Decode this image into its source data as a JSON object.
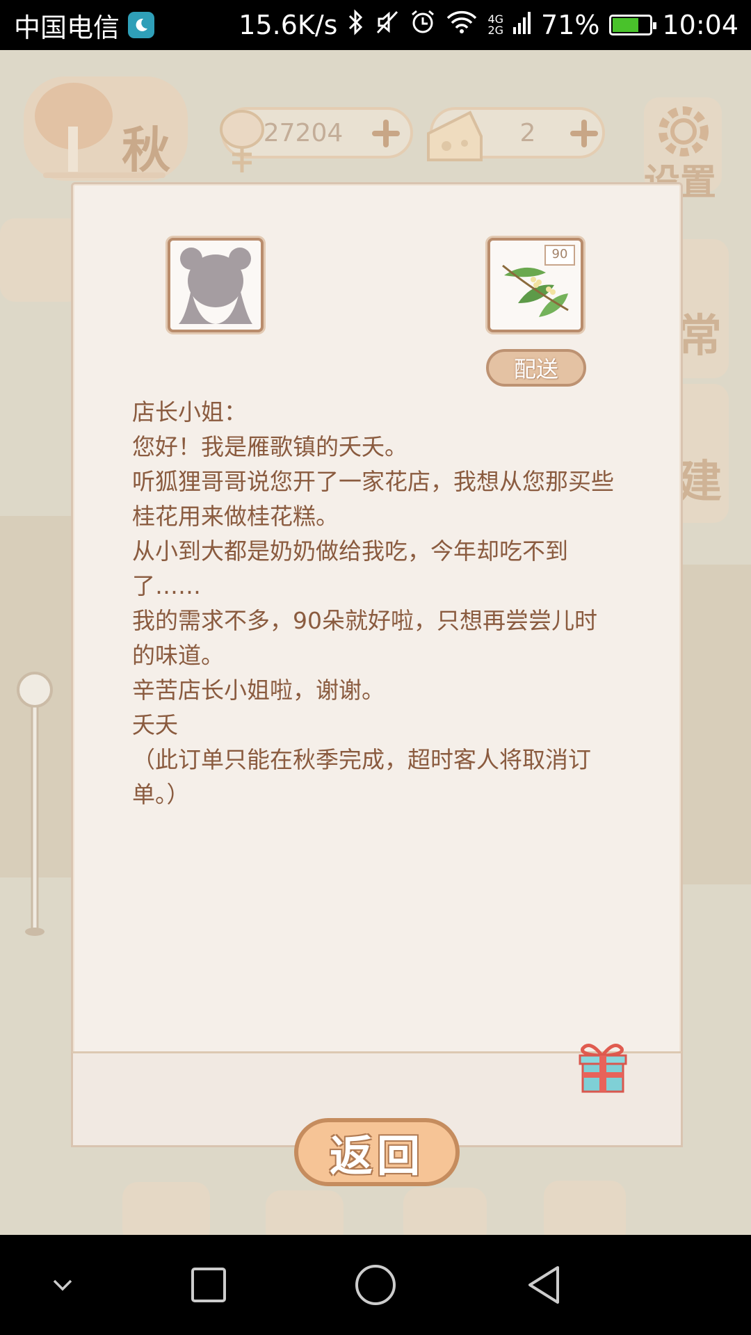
{
  "status_bar": {
    "carrier": "中国电信",
    "net_speed": "15.6K/s",
    "network_top": "4G",
    "network_bottom": "2G",
    "battery": "71%",
    "battery_level": 0.71,
    "time": "10:04",
    "icons": [
      "moon-icon",
      "bluetooth-icon",
      "mute-icon",
      "alarm-icon",
      "wifi-icon",
      "signal-icon",
      "battery-icon"
    ]
  },
  "game_hud": {
    "season": "秋",
    "fish_count": "27204",
    "cheese_count": "2",
    "settings_label": "设置",
    "side_labels": [
      "常",
      "建"
    ]
  },
  "letter": {
    "item_count": "90",
    "deliver_label": "配送",
    "lines": [
      "店长小姐：",
      "您好！我是雁歌镇的夭夭。",
      "听狐狸哥哥说您开了一家花店，我想从您那买些桂花用来做桂花糕。",
      "从小到大都是奶奶做给我吃，今年却吃不到了……",
      "我的需求不多，90朵就好啦，只想再尝尝儿时的味道。",
      "辛苦店长小姐啦，谢谢。",
      "夭夭",
      "（此订单只能在秋季完成，超时客人将取消订单。）"
    ]
  },
  "back_label": "返回",
  "colors": {
    "paper": "#f5efe9",
    "text_brown": "#8a5b3f",
    "button_orange": "#f6c496",
    "frame_brown": "#b98c6c"
  }
}
